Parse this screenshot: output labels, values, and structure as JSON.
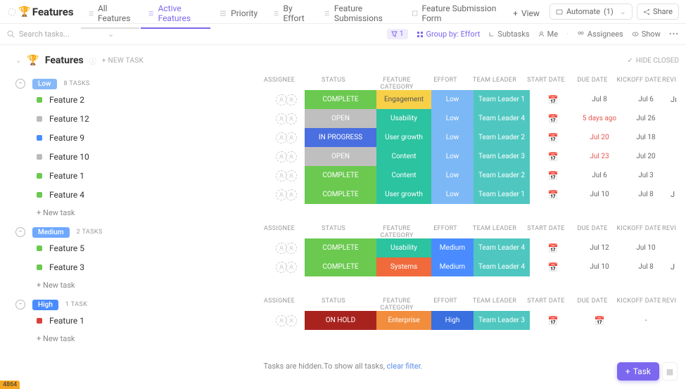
{
  "header": {
    "title": "Features",
    "tabs": [
      {
        "label": "All Features"
      },
      {
        "label": "Active Features"
      },
      {
        "label": "Priority"
      },
      {
        "label": "By Effort"
      },
      {
        "label": "Feature Submissions"
      },
      {
        "label": "Feature Submission Form"
      }
    ],
    "view": "View",
    "automate": "Automate",
    "automate_count": "(1)",
    "share": "Share"
  },
  "filters": {
    "search_placeholder": "Search tasks...",
    "filter_count": "1",
    "group_by": "Group by: Effort",
    "subtasks": "Subtasks",
    "me": "Me",
    "assignees": "Assignees",
    "show": "Show"
  },
  "list_header": {
    "title": "Features",
    "new_task": "+ NEW TASK",
    "hide_closed": "HIDE CLOSED"
  },
  "columns": {
    "assignee": "ASSIGNEE",
    "status": "STATUS",
    "category": "FEATURE CATEGORY",
    "effort": "EFFORT",
    "leader": "TEAM LEADER",
    "start": "START DATE",
    "due": "DUE DATE",
    "kickoff": "KICKOFF DATE",
    "review": "REVI"
  },
  "groups": [
    {
      "name": "Low",
      "pill_class": "low",
      "count": "8 TASKS",
      "tasks": [
        {
          "sq": "green",
          "name": "Feature 2",
          "status": "COMPLETE",
          "status_c": "c-complete",
          "cat": "Engagement",
          "cat_c": "c-engagement",
          "effort": "Low",
          "effort_c": "c-low",
          "leader": "Team Leader 1",
          "due": "Jul 8",
          "due_red": false,
          "kick": "Jul 6",
          "rev": "Jı"
        },
        {
          "sq": "grey",
          "name": "Feature 12",
          "status": "OPEN",
          "status_c": "c-open",
          "cat": "Usability",
          "cat_c": "c-usability",
          "effort": "Low",
          "effort_c": "c-low",
          "leader": "Team Leader 4",
          "due": "5 days ago",
          "due_red": true,
          "kick": "Jul 26",
          "rev": ""
        },
        {
          "sq": "blue",
          "name": "Feature 9",
          "status": "IN PROGRESS",
          "status_c": "c-progress",
          "cat": "User growth",
          "cat_c": "c-usergrowth",
          "effort": "Low",
          "effort_c": "c-low",
          "leader": "Team Leader 2",
          "due": "Jul 20",
          "due_red": true,
          "kick": "Jul 18",
          "rev": ""
        },
        {
          "sq": "grey",
          "name": "Feature 10",
          "status": "OPEN",
          "status_c": "c-open",
          "cat": "Content",
          "cat_c": "c-content",
          "effort": "Low",
          "effort_c": "c-low",
          "leader": "Team Leader 3",
          "due": "Jul 23",
          "due_red": true,
          "kick": "Jul 20",
          "rev": ""
        },
        {
          "sq": "green",
          "name": "Feature 1",
          "status": "COMPLETE",
          "status_c": "c-complete",
          "cat": "Content",
          "cat_c": "c-content",
          "effort": "Low",
          "effort_c": "c-low",
          "leader": "Team Leader 2",
          "due": "Jul 6",
          "due_red": false,
          "kick": "Jul 3",
          "rev": ""
        },
        {
          "sq": "green",
          "name": "Feature 4",
          "status": "COMPLETE",
          "status_c": "c-complete",
          "cat": "User growth",
          "cat_c": "c-usergrowth",
          "effort": "Low",
          "effort_c": "c-low",
          "leader": "Team Leader 1",
          "due": "Jul 10",
          "due_red": false,
          "kick": "Jul 8",
          "rev": "J"
        }
      ]
    },
    {
      "name": "Medium",
      "pill_class": "medium",
      "count": "2 TASKS",
      "tasks": [
        {
          "sq": "green",
          "name": "Feature 5",
          "status": "COMPLETE",
          "status_c": "c-complete",
          "cat": "Usability",
          "cat_c": "c-usability",
          "effort": "Medium",
          "effort_c": "c-medium",
          "leader": "Team Leader 4",
          "due": "Jul 12",
          "due_red": false,
          "kick": "Jul 10",
          "rev": ""
        },
        {
          "sq": "green",
          "name": "Feature 3",
          "status": "COMPLETE",
          "status_c": "c-complete",
          "cat": "Systems",
          "cat_c": "c-systems",
          "effort": "Medium",
          "effort_c": "c-medium",
          "leader": "Team Leader 4",
          "due": "Jul 10",
          "due_red": false,
          "kick": "Jul 8",
          "rev": "J"
        }
      ]
    },
    {
      "name": "High",
      "pill_class": "high",
      "count": "1 TASK",
      "tasks": [
        {
          "sq": "red",
          "name": "Feature 1",
          "status": "ON HOLD",
          "status_c": "c-hold",
          "cat": "Enterprise",
          "cat_c": "c-enterprise",
          "effort": "High",
          "effort_c": "c-high",
          "leader": "Team Leader 3",
          "due": "",
          "due_red": false,
          "kick": "-",
          "rev": ""
        }
      ]
    }
  ],
  "new_task_row": "+ New task",
  "footer": {
    "text": "Tasks are hidden.To show all tasks, ",
    "link": "clear filter"
  },
  "task_button": "Task",
  "corner": "4864"
}
